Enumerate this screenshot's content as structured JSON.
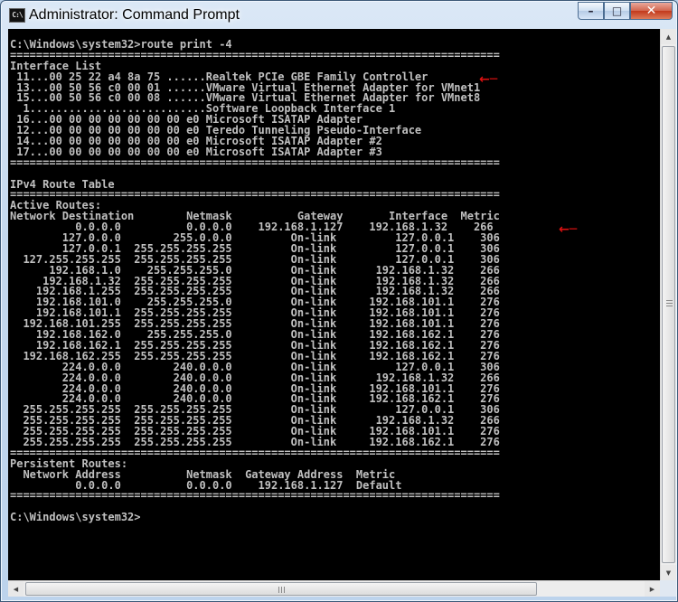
{
  "window": {
    "title": "Administrator: Command Prompt",
    "app_icon": "cmd-icon",
    "controls": {
      "minimize": "–",
      "maximize": "□",
      "close": "✕"
    }
  },
  "console": {
    "lines": [
      "C:\\Windows\\system32>route print -4",
      "===========================================================================",
      "Interface List",
      " 11...00 25 22 a4 8a 75 ......Realtek PCIe GBE Family Controller",
      " 13...00 50 56 c0 00 01 ......VMware Virtual Ethernet Adapter for VMnet1",
      " 15...00 50 56 c0 00 08 ......VMware Virtual Ethernet Adapter for VMnet8",
      "  1...........................Software Loopback Interface 1",
      " 16...00 00 00 00 00 00 00 e0 Microsoft ISATAP Adapter",
      " 12...00 00 00 00 00 00 00 e0 Teredo Tunneling Pseudo-Interface",
      " 14...00 00 00 00 00 00 00 e0 Microsoft ISATAP Adapter #2",
      " 17...00 00 00 00 00 00 00 e0 Microsoft ISATAP Adapter #3",
      "===========================================================================",
      "",
      "IPv4 Route Table",
      "===========================================================================",
      "Active Routes:",
      "Network Destination        Netmask          Gateway       Interface  Metric",
      "          0.0.0.0          0.0.0.0    192.168.1.127    192.168.1.32    266",
      "        127.0.0.0        255.0.0.0         On-link         127.0.0.1    306",
      "        127.0.0.1  255.255.255.255         On-link         127.0.0.1    306",
      "  127.255.255.255  255.255.255.255         On-link         127.0.0.1    306",
      "      192.168.1.0    255.255.255.0         On-link      192.168.1.32    266",
      "     192.168.1.32  255.255.255.255         On-link      192.168.1.32    266",
      "    192.168.1.255  255.255.255.255         On-link      192.168.1.32    266",
      "    192.168.101.0    255.255.255.0         On-link     192.168.101.1    276",
      "    192.168.101.1  255.255.255.255         On-link     192.168.101.1    276",
      "  192.168.101.255  255.255.255.255         On-link     192.168.101.1    276",
      "    192.168.162.0    255.255.255.0         On-link     192.168.162.1    276",
      "    192.168.162.1  255.255.255.255         On-link     192.168.162.1    276",
      "  192.168.162.255  255.255.255.255         On-link     192.168.162.1    276",
      "        224.0.0.0        240.0.0.0         On-link         127.0.0.1    306",
      "        224.0.0.0        240.0.0.0         On-link      192.168.1.32    266",
      "        224.0.0.0        240.0.0.0         On-link     192.168.101.1    276",
      "        224.0.0.0        240.0.0.0         On-link     192.168.162.1    276",
      "  255.255.255.255  255.255.255.255         On-link         127.0.0.1    306",
      "  255.255.255.255  255.255.255.255         On-link      192.168.1.32    266",
      "  255.255.255.255  255.255.255.255         On-link     192.168.101.1    276",
      "  255.255.255.255  255.255.255.255         On-link     192.168.162.1    276",
      "===========================================================================",
      "Persistent Routes:",
      "  Network Address          Netmask  Gateway Address  Metric",
      "          0.0.0.0          0.0.0.0    192.168.1.127  Default",
      "===========================================================================",
      "",
      "C:\\Windows\\system32>"
    ],
    "annotation_color": "#e01010"
  },
  "scrollbars": {
    "up_arrow": "▲",
    "down_arrow": "▼",
    "left_arrow": "◀",
    "right_arrow": "▶"
  }
}
